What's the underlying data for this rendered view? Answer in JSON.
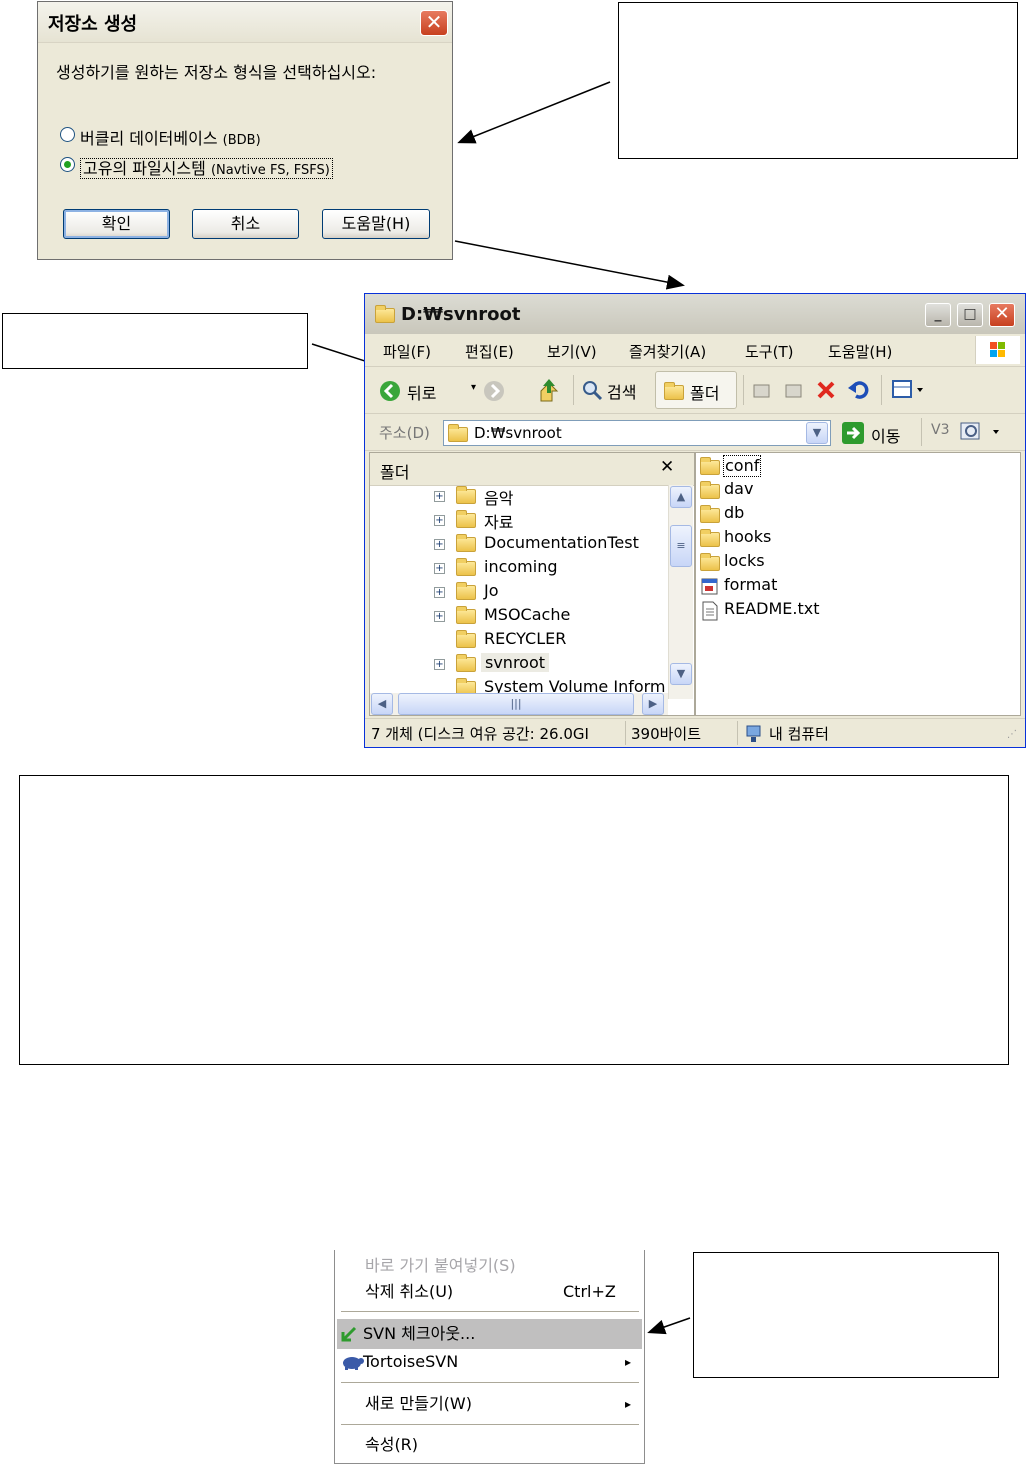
{
  "dialog": {
    "title": "저장소 생성",
    "close_glyph": "✕",
    "prompt": "생성하기를 원하는 저장소 형식을 선택하십시오:",
    "options": [
      {
        "label": "버클리 데이터베이스",
        "suffix": "(BDB)",
        "selected": false
      },
      {
        "label": "고유의 파일시스템",
        "suffix": "(Navtive FS, FSFS)",
        "selected": true
      }
    ],
    "buttons": {
      "ok": "확인",
      "cancel": "취소",
      "help": "도움말(H)"
    }
  },
  "explorer": {
    "title": "D:₩svnroot",
    "window_buttons": {
      "minimize": "_",
      "maximize": "□",
      "close": "✕"
    },
    "menu": [
      "파일(F)",
      "편집(E)",
      "보기(V)",
      "즐겨찾기(A)",
      "도구(T)",
      "도움말(H)"
    ],
    "toolbar": {
      "back": "뒤로",
      "search": "검색",
      "folders": "폴더"
    },
    "address": {
      "label": "주소(D)",
      "value": "D:₩svnroot",
      "go": "이동",
      "v3": "V3"
    },
    "folder_pane": {
      "title": "폴더",
      "close_glyph": "✕",
      "items": [
        {
          "name": "음악",
          "expandable": true
        },
        {
          "name": "자료",
          "expandable": true
        },
        {
          "name": "DocumentationTest",
          "expandable": true
        },
        {
          "name": "incoming",
          "expandable": true
        },
        {
          "name": "Jo",
          "expandable": true
        },
        {
          "name": "MSOCache",
          "expandable": true
        },
        {
          "name": "RECYCLER",
          "expandable": false
        },
        {
          "name": "svnroot",
          "expandable": true,
          "selected": true
        },
        {
          "name": "System Volume Inform",
          "expandable": false,
          "clipped": true
        }
      ]
    },
    "files": [
      {
        "name": "conf",
        "type": "folder"
      },
      {
        "name": "dav",
        "type": "folder"
      },
      {
        "name": "db",
        "type": "folder"
      },
      {
        "name": "hooks",
        "type": "folder"
      },
      {
        "name": "locks",
        "type": "folder"
      },
      {
        "name": "format",
        "type": "file"
      },
      {
        "name": "README.txt",
        "type": "text"
      }
    ],
    "status": {
      "objects": "7 개체 (디스크 여유 공간: 26.0GI",
      "size": "390바이트",
      "location": "내 컴퓨터"
    }
  },
  "context_menu": {
    "items": [
      {
        "label": "바로 가기 붙여넣기(S)",
        "disabled": true
      },
      {
        "label": "삭제 취소(U)",
        "shortcut": "Ctrl+Z"
      },
      {
        "label": "SVN 체크아웃...",
        "highlighted": true,
        "icon": "svn-checkout-icon"
      },
      {
        "label": "TortoiseSVN",
        "submenu": true,
        "icon": "tortoise-icon"
      },
      {
        "label": "새로 만들기(W)",
        "submenu": true
      },
      {
        "label": "속성(R)"
      }
    ],
    "submenu_glyph": "▸"
  },
  "colors": {
    "xp_face": "#ece9d8",
    "xp_blue": "#0831d9",
    "close_red": "#c7401f",
    "highlight": "#c0bfbf"
  }
}
